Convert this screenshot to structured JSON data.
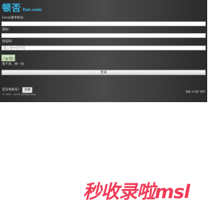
{
  "logo": {
    "main": "顿否",
    "sub": "fun.com"
  },
  "form": {
    "email_label": "Email或手机号：",
    "email_value": "",
    "password_label": "密码：",
    "password_value": "",
    "captcha_label": "验证码：",
    "captcha_placeholder": "输入图中的字符",
    "captcha_image_text": "大节",
    "refresh_label": "看不清，换一张",
    "login_label": "登录"
  },
  "footer": {
    "question": "还没有帐号？",
    "register_label": "注册",
    "copyright": "© 2007 - 2023 Lfunfun.com",
    "powered_by": "程序 4X 推广研究"
  },
  "banner": {
    "text": "秒收录啦msl"
  },
  "colors": {
    "logo": "#3fb6e0",
    "background": "#3a3a3a",
    "banner": "#f03c58"
  }
}
